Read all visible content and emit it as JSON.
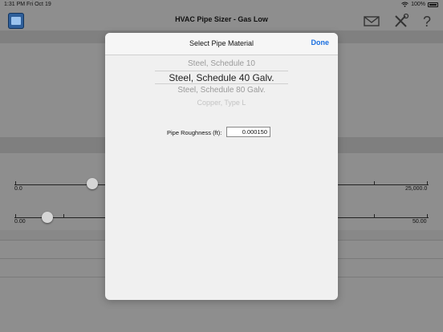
{
  "status": {
    "time": "1:31 PM",
    "date": "Fri Oct 19",
    "battery": "100%"
  },
  "nav": {
    "title": "HVAC Pipe Sizer - Gas Low"
  },
  "background": {
    "slider1": {
      "min_label": "0.0",
      "max_label": "25,000.0"
    },
    "slider2": {
      "min_label": "0.00",
      "max_label": "50.00"
    }
  },
  "modal": {
    "title": "Select Pipe Material",
    "done_label": "Done",
    "picker_options": [
      "Steel, Schedule 10",
      "Steel, Schedule 40 Galv.",
      "Steel, Schedule 80 Galv.",
      "Copper, Type L"
    ],
    "selected_option": "Steel, Schedule 40 Galv.",
    "roughness_label": "Pipe Roughness (ft):",
    "roughness_value": "0.000150"
  },
  "colors": {
    "accent": "#1a6fe0",
    "dim_overlay": "#8e8e8e"
  },
  "icons": [
    "app-icon",
    "mail-icon",
    "tools-icon",
    "help-icon",
    "wifi-icon",
    "battery-icon"
  ]
}
